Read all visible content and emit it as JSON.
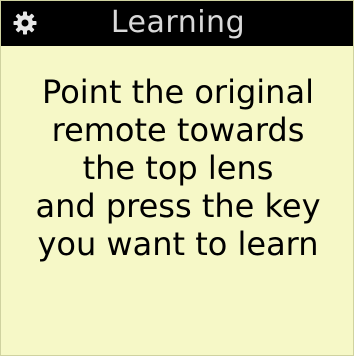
{
  "header": {
    "title": "Learning",
    "settings_icon": "gear-icon"
  },
  "instruction": {
    "lines": [
      "Point the original",
      "remote towards",
      "the top lens",
      "and press the key",
      "you want to learn"
    ]
  },
  "colors": {
    "background": "#f6f8c7",
    "header_background": "#000000",
    "header_text": "#d9d9d9",
    "body_text": "#000000"
  }
}
